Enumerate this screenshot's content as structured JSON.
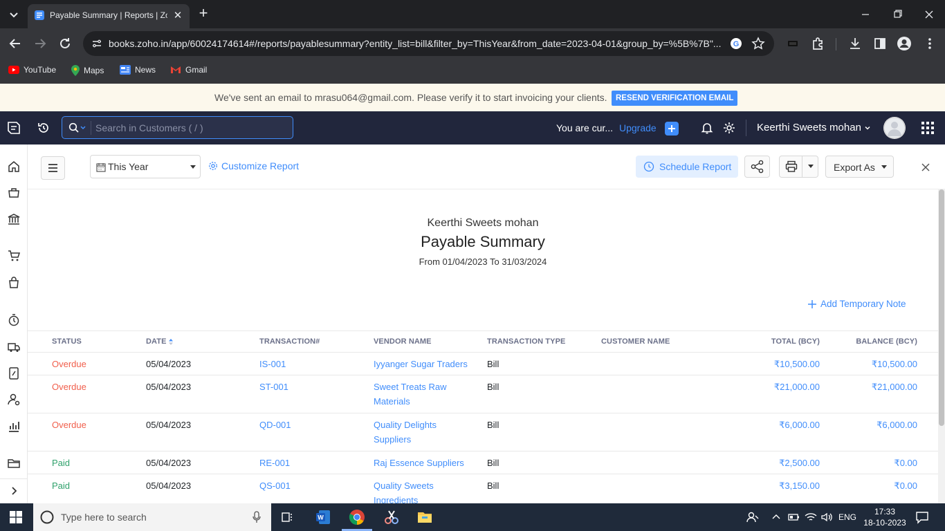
{
  "browser": {
    "tab_title": "Payable Summary | Reports | Zoho Books",
    "url": "books.zoho.in/app/60024174614#/reports/payablesummary?entity_list=bill&filter_by=ThisYear&from_date=2023-04-01&group_by=%5B%7B\"...",
    "bookmarks": [
      {
        "label": "YouTube",
        "icon": "youtube-icon"
      },
      {
        "label": "Maps",
        "icon": "maps-icon"
      },
      {
        "label": "News",
        "icon": "news-icon"
      },
      {
        "label": "Gmail",
        "icon": "gmail-icon"
      }
    ]
  },
  "banner": {
    "message": "We've sent an email to mrasu064@gmail.com. Please verify it to start invoicing your clients.",
    "button": "RESEND VERIFICATION EMAIL"
  },
  "header": {
    "search_placeholder": "Search in Customers ( / )",
    "trial_text": "You are cur...",
    "upgrade": "Upgrade",
    "org_name": "Keerthi Sweets mohan"
  },
  "toolbar": {
    "period": "This Year",
    "customize": "Customize Report",
    "schedule": "Schedule Report",
    "export": "Export As"
  },
  "report": {
    "org": "Keerthi Sweets mohan",
    "title": "Payable Summary",
    "range": "From 01/04/2023 To 31/03/2024",
    "add_note": "Add Temporary Note",
    "columns": [
      "STATUS",
      "DATE",
      "TRANSACTION#",
      "VENDOR NAME",
      "TRANSACTION TYPE",
      "CUSTOMER NAME",
      "TOTAL (BCY)",
      "BALANCE (BCY)"
    ],
    "rows": [
      {
        "status": "Overdue",
        "date": "05/04/2023",
        "txn": "IS-001",
        "vendor1": "Iyyanger Sugar Traders",
        "vendor2": "",
        "type": "Bill",
        "customer": "",
        "total": "₹10,500.00",
        "balance": "₹10,500.00"
      },
      {
        "status": "Overdue",
        "date": "05/04/2023",
        "txn": "ST-001",
        "vendor1": "Sweet Treats Raw",
        "vendor2": "Materials",
        "type": "Bill",
        "customer": "",
        "total": "₹21,000.00",
        "balance": "₹21,000.00"
      },
      {
        "status": "Overdue",
        "date": "05/04/2023",
        "txn": "QD-001",
        "vendor1": "Quality Delights",
        "vendor2": "Suppliers",
        "type": "Bill",
        "customer": "",
        "total": "₹6,000.00",
        "balance": "₹6,000.00"
      },
      {
        "status": "Paid",
        "date": "05/04/2023",
        "txn": "RE-001",
        "vendor1": "Raj Essence Suppliers",
        "vendor2": "",
        "type": "Bill",
        "customer": "",
        "total": "₹2,500.00",
        "balance": "₹0.00"
      },
      {
        "status": "Paid",
        "date": "05/04/2023",
        "txn": "QS-001",
        "vendor1": "Quality Sweets",
        "vendor2": "Ingredients",
        "type": "Bill",
        "customer": "",
        "total": "₹3,150.00",
        "balance": "₹0.00"
      }
    ]
  },
  "taskbar": {
    "search_placeholder": "Type here to search",
    "lang": "ENG",
    "time": "17:33",
    "date": "18-10-2023"
  },
  "colors": {
    "accent": "#408dfb",
    "overdue": "#f15f4c",
    "paid": "#2fa16b",
    "header_bg": "#21263c"
  }
}
